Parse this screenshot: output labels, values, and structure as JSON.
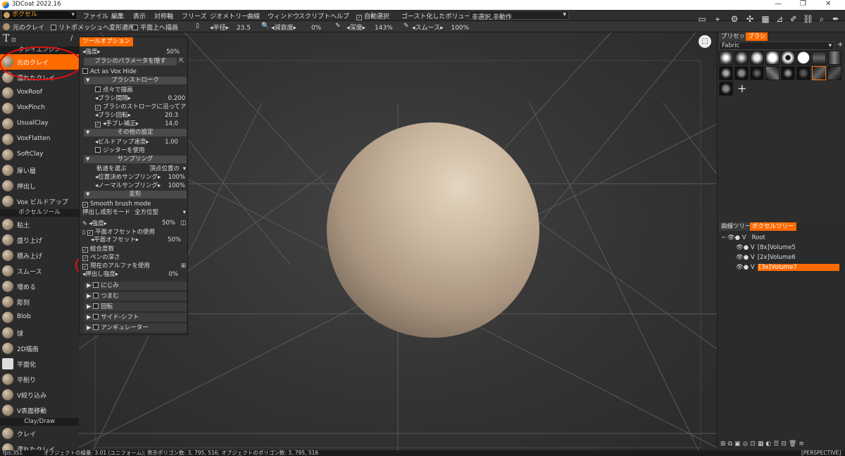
{
  "titlebar": {
    "title": "3DCoat 2022.16",
    "minimize": "—",
    "maximize": "❐",
    "close": "✕"
  },
  "menubar": {
    "room": "ボクセル",
    "items": [
      "ファイル",
      "編集",
      "表示",
      "対称軸",
      "フリーズ",
      "ジオメトリー",
      "曲線",
      "ウィンドウ",
      "スクリプト",
      "ヘルプ"
    ],
    "auto_select": "自動選択",
    "ghost_label": "ゴースト化したボリューム:",
    "ghost_value": "非選択,非動作"
  },
  "toolbar": {
    "tool_name": "元のクレイ",
    "retopo": "リトポメッシュへ変形適用",
    "plane_draw": "平面上へ描画",
    "radius_label": "半径",
    "radius_value": "23.5",
    "falloff_label": "減衰度",
    "falloff_value": "0%",
    "depth_label": "深度",
    "depth_value": "143%",
    "smooth_label": "スムース",
    "smooth_value": "100%"
  },
  "left": {
    "section1": "クレイエンジン",
    "tools1": [
      "元のクレイ",
      "濡れたクレイ",
      "VoxRoof",
      "VoxPinch",
      "UsualClay",
      "VoxFlatten",
      "SoftClay",
      "厚い層",
      "押出し",
      "Vox ビルドアップ"
    ],
    "section2": "ボクセルツール",
    "tools2": [
      "粘土",
      "盛り上げ",
      "積み上げ",
      "スムース",
      "埋める",
      "彫刻",
      "Blob",
      "球",
      "2D描画",
      "平面化",
      "平削り",
      "V絞り込み",
      "V表面移動"
    ],
    "section3": "Clay/Draw",
    "tools3": [
      "クレイ",
      "濡れたクレイ"
    ]
  },
  "tooloptions": {
    "tab": "ツールオプション",
    "strength_label": "強度",
    "strength_value": "50%",
    "hide_brush_params": "ブラシのパラメータを隠す",
    "act_as_vox_hide": "Act as Vox Hide",
    "group_brush_stroke": "ブラシストローク",
    "dot_draw": "点々で描画",
    "brush_spacing_label": "ブラシ間隔",
    "brush_spacing_value": "0.200",
    "follow_stroke": "ブラシのストロークに沿ってアル",
    "brush_rotation_label": "ブラシ回転",
    "brush_rotation_value": "20.3",
    "jitter_correct_label": "手ブレ補正",
    "jitter_correct_value": "14.0",
    "group_other": "その他の設定",
    "buildup_speed_label": "ビルドアップ速度",
    "buildup_speed_value": "1.00",
    "use_jitter": "ジッターを使用",
    "group_sampling": "サンプリング",
    "trajectory_label": "軌道を選ぶ",
    "trajectory_value": "頂点位置の",
    "position_sampling_label": "位置決めサンプリング",
    "position_sampling_value": "100%",
    "normal_sampling_label": "ノーマルサンプリング",
    "normal_sampling_value": "100%",
    "group_transform": "変形",
    "smooth_brush_mode": "Smooth brush mode",
    "extrude_mode_label": "押出し成形モード",
    "extrude_mode_value": "全方位型",
    "strength2_label": "強度",
    "strength2_value": "50%",
    "use_plane_offset": "平面オフセットの使用",
    "plane_offset_label": "平面オフセット",
    "plane_offset_value": "50%",
    "total_depth": "総合度数",
    "pen_depth": "ペンの深さ",
    "use_alpha": "現在のアルファを使用",
    "extrude_strength_label": "押出し強度",
    "extrude_strength_value": "0%",
    "collapsed": [
      "にじみ",
      "つまむ",
      "回転",
      "サイド-シフト",
      "アンギュレーター"
    ]
  },
  "right": {
    "tab_presets": "プリセット",
    "tab_brush": "ブラシ",
    "brush_category": "Fabric",
    "tab_curve_tree": "曲線ツリー",
    "tab_voxel_tree": "ボクセルツリー",
    "tree": [
      {
        "label": "Root",
        "prefix": "V",
        "level": 0,
        "selected": false
      },
      {
        "label": "[8x]Volume5",
        "prefix": "V",
        "level": 1,
        "selected": false
      },
      {
        "label": "[2x]Volume6",
        "prefix": "V",
        "level": 1,
        "selected": false
      },
      {
        "label": "[3x]Volume7",
        "prefix": "V",
        "level": 1,
        "selected": true
      }
    ]
  },
  "viewport": {
    "projection": "[PERSPECTIVE]"
  },
  "statusbar": {
    "fps": "fps:351",
    "info": "オブジェクトの線量: 3.01 (ユニフォーム); 表示ポリゴン数: 3, 795, 516; オブジェクトのポリゴン数: 3, 795, 516"
  },
  "colors": {
    "accent": "#ff6a00",
    "background": "#2d2d2d",
    "sphere": "#c7b49c"
  }
}
